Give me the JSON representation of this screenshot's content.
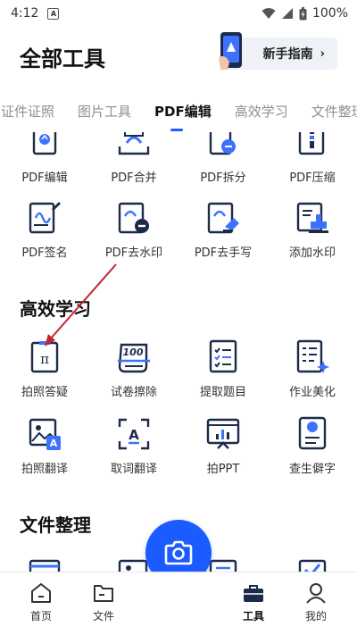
{
  "status_bar": {
    "time": "4:12",
    "notif_glyph": "A",
    "battery": "100%"
  },
  "header": {
    "title": "全部工具",
    "guide_label": "新手指南",
    "guide_chevron": "›"
  },
  "tabs": [
    {
      "label": "证件证照",
      "active": false
    },
    {
      "label": "图片工具",
      "active": false
    },
    {
      "label": "PDF编辑",
      "active": true
    },
    {
      "label": "高效学习",
      "active": false
    },
    {
      "label": "文件整理",
      "active": false
    }
  ],
  "pdf_row1": [
    {
      "label": "PDF编辑",
      "icon": "pdf-edit-icon"
    },
    {
      "label": "PDF合并",
      "icon": "pdf-merge-icon"
    },
    {
      "label": "PDF拆分",
      "icon": "pdf-split-icon"
    },
    {
      "label": "PDF压缩",
      "icon": "pdf-compress-icon"
    }
  ],
  "pdf_row2": [
    {
      "label": "PDF签名",
      "icon": "pdf-sign-icon"
    },
    {
      "label": "PDF去水印",
      "icon": "pdf-remove-watermark-icon"
    },
    {
      "label": "PDF去手写",
      "icon": "pdf-remove-handwriting-icon"
    },
    {
      "label": "添加水印",
      "icon": "add-watermark-icon"
    }
  ],
  "study": {
    "title": "高效学习",
    "row1": [
      {
        "label": "拍照答疑",
        "icon": "photo-answer-icon"
      },
      {
        "label": "试卷擦除",
        "icon": "exam-erase-icon"
      },
      {
        "label": "提取题目",
        "icon": "extract-question-icon"
      },
      {
        "label": "作业美化",
        "icon": "homework-beautify-icon"
      }
    ],
    "row2": [
      {
        "label": "拍照翻译",
        "icon": "photo-translate-icon"
      },
      {
        "label": "取词翻译",
        "icon": "word-translate-icon"
      },
      {
        "label": "拍PPT",
        "icon": "photo-ppt-icon"
      },
      {
        "label": "查生僻字",
        "icon": "rare-char-icon"
      }
    ]
  },
  "files": {
    "title": "文件整理"
  },
  "bottom_nav": [
    {
      "label": "首页",
      "icon": "home-icon",
      "active": false
    },
    {
      "label": "文件",
      "icon": "folder-icon",
      "active": false
    },
    {
      "label": "工具",
      "icon": "toolbox-icon",
      "active": true
    },
    {
      "label": "我的",
      "icon": "user-icon",
      "active": false
    }
  ],
  "colors": {
    "accent": "#1a5cff",
    "icon_dark": "#1d2b4a"
  }
}
